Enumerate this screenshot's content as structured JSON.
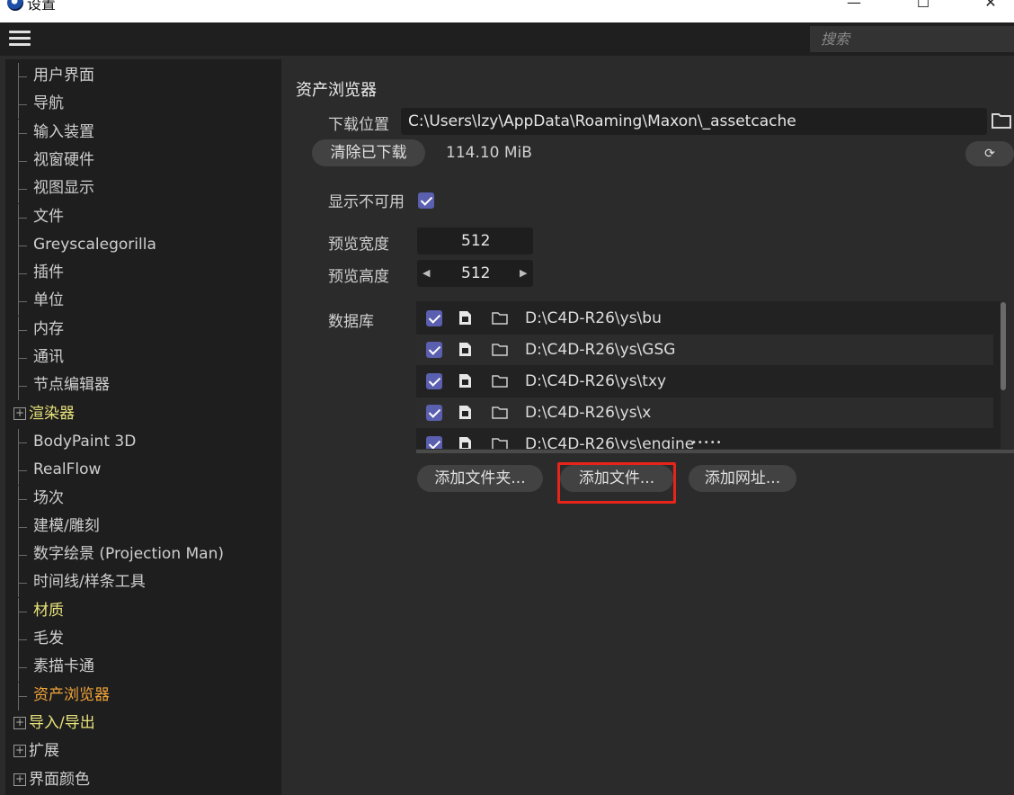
{
  "window": {
    "title": "设置",
    "minimize": "—",
    "maximize": "☐",
    "close": "✕"
  },
  "toolbar": {
    "search_placeholder": "搜索"
  },
  "sidebar": {
    "items": [
      {
        "label": "用户界面",
        "style": "normal",
        "expandable": false
      },
      {
        "label": "导航",
        "style": "normal",
        "expandable": false
      },
      {
        "label": "输入装置",
        "style": "normal",
        "expandable": false
      },
      {
        "label": "视窗硬件",
        "style": "normal",
        "expandable": false
      },
      {
        "label": "视图显示",
        "style": "normal",
        "expandable": false
      },
      {
        "label": "文件",
        "style": "normal",
        "expandable": false
      },
      {
        "label": "Greyscalegorilla",
        "style": "normal",
        "expandable": false
      },
      {
        "label": "插件",
        "style": "normal",
        "expandable": false
      },
      {
        "label": "单位",
        "style": "normal",
        "expandable": false
      },
      {
        "label": "内存",
        "style": "normal",
        "expandable": false
      },
      {
        "label": "通讯",
        "style": "normal",
        "expandable": false
      },
      {
        "label": "节点编辑器",
        "style": "normal",
        "expandable": false
      },
      {
        "label": "渲染器",
        "style": "yellow",
        "expandable": true
      },
      {
        "label": "BodyPaint 3D",
        "style": "normal",
        "expandable": false
      },
      {
        "label": "RealFlow",
        "style": "normal",
        "expandable": false
      },
      {
        "label": "场次",
        "style": "normal",
        "expandable": false
      },
      {
        "label": "建模/雕刻",
        "style": "normal",
        "expandable": false
      },
      {
        "label": "数字绘景 (Projection Man)",
        "style": "normal",
        "expandable": false
      },
      {
        "label": "时间线/样条工具",
        "style": "normal",
        "expandable": false
      },
      {
        "label": "材质",
        "style": "yellow",
        "expandable": false
      },
      {
        "label": "毛发",
        "style": "normal",
        "expandable": false
      },
      {
        "label": "素描卡通",
        "style": "normal",
        "expandable": false
      },
      {
        "label": "资产浏览器",
        "style": "orange",
        "expandable": false
      },
      {
        "label": "导入/导出",
        "style": "yellow",
        "expandable": true
      },
      {
        "label": "扩展",
        "style": "normal",
        "expandable": true
      },
      {
        "label": "界面颜色",
        "style": "normal",
        "expandable": true
      }
    ]
  },
  "main": {
    "section_title": "资产浏览器",
    "download_location_label": "下载位置",
    "download_path": "C:\\Users\\lzy\\AppData\\Roaming\\Maxon\\_assetcache",
    "clear_downloads_label": "清除已下载",
    "downloads_size": "114.10 MiB",
    "refresh_icon": "⟳",
    "show_unavailable_label": "显示不可用",
    "show_unavailable_checked": true,
    "preview_width_label": "预览宽度",
    "preview_width": "512",
    "preview_height_label": "预览高度",
    "preview_height": "512",
    "arrow_left": "◀",
    "arrow_right": "▶",
    "database_label": "数据库",
    "databases": [
      {
        "path": "D:\\C4D-R26\\ys\\bu",
        "checked": true
      },
      {
        "path": "D:\\C4D-R26\\ys\\GSG",
        "checked": true
      },
      {
        "path": "D:\\C4D-R26\\ys\\txy",
        "checked": true
      },
      {
        "path": "D:\\C4D-R26\\ys\\x",
        "checked": true
      },
      {
        "path": "D:\\C4D-R26\\ys\\engine",
        "checked": true
      }
    ],
    "add_folder_label": "添加文件夹...",
    "add_file_label": "添加文件...",
    "add_url_label": "添加网址..."
  },
  "colors": {
    "highlight": "#e8241a",
    "checkbox": "#5a5fb0",
    "yellow_text": "#e8e27a",
    "orange_text": "#f0a43a"
  }
}
